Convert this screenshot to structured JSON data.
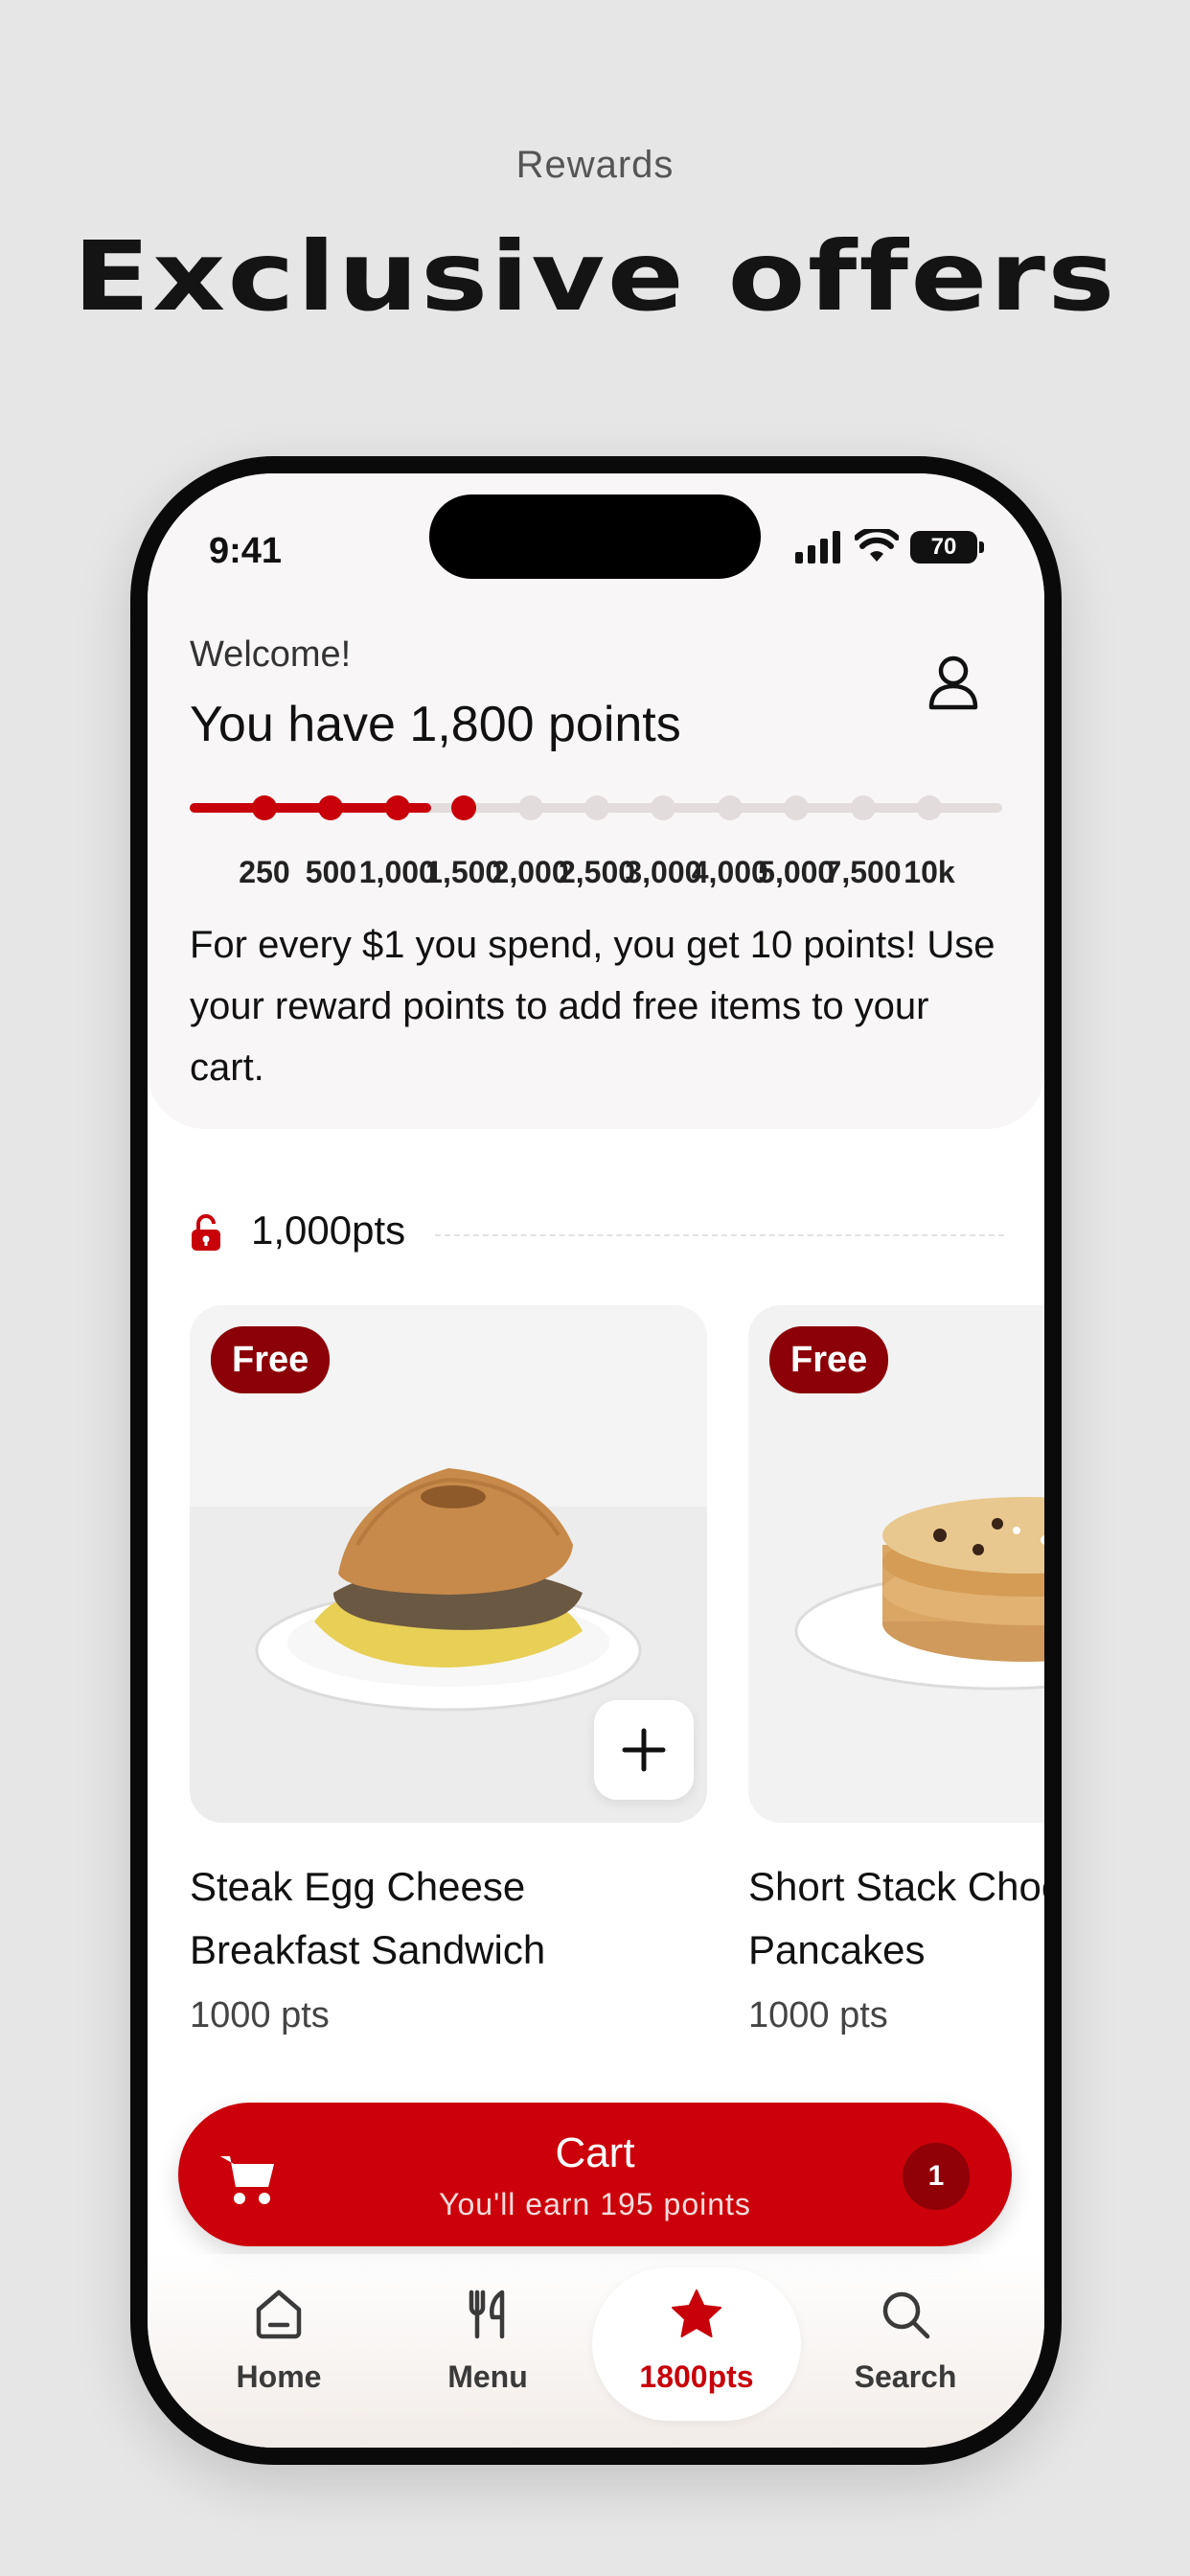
{
  "marketing": {
    "eyebrow": "Rewards",
    "headline": "Exclusive offers"
  },
  "status_bar": {
    "time": "9:41",
    "battery": "70"
  },
  "header": {
    "welcome": "Welcome!",
    "points_title": "You have 1,800 points",
    "info_text": "For every $1 you spend, you get 10 points! Use your reward points to add free items to your cart."
  },
  "progress": {
    "current_points": 1800,
    "milestones": [
      "250",
      "500",
      "1,000",
      "1,500",
      "2,000",
      "2,500",
      "3,000",
      "4,000",
      "5,000",
      "7,500",
      "10k"
    ],
    "reached_count": 4
  },
  "tier": {
    "label": "1,000pts"
  },
  "rewards": [
    {
      "badge": "Free",
      "name": "Steak Egg Cheese\nBreakfast Sandwich",
      "points": "1000 pts"
    },
    {
      "badge": "Free",
      "name": "Short Stack Chocolate Chip\nPancakes",
      "points": "1000 pts"
    }
  ],
  "cart": {
    "title": "Cart",
    "subtitle": "You'll earn 195 points",
    "count": "1"
  },
  "nav": {
    "items": [
      {
        "label": "Home",
        "icon": "home-icon"
      },
      {
        "label": "Menu",
        "icon": "fork-knife-icon"
      },
      {
        "label": "1800pts",
        "icon": "star-icon"
      },
      {
        "label": "Search",
        "icon": "search-icon"
      }
    ]
  },
  "colors": {
    "brand_red": "#c8000a",
    "badge_red": "#8c0007",
    "track_gray": "#e3dcdc"
  }
}
